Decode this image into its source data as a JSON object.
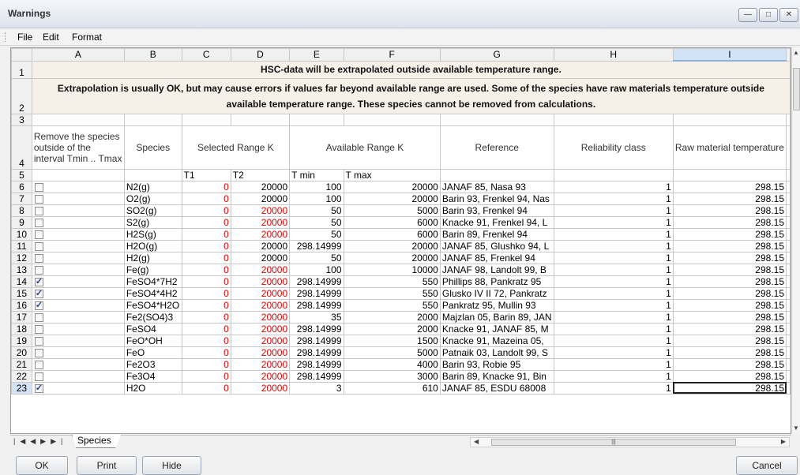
{
  "window": {
    "title": "Warnings"
  },
  "menu": [
    "File",
    "Edit",
    "Format"
  ],
  "columns": [
    "A",
    "B",
    "C",
    "D",
    "E",
    "F",
    "G",
    "H",
    "I"
  ],
  "banner": {
    "line1": "HSC-data will be extrapolated outside available temperature range.",
    "line2": "Extrapolation is usually OK, but may cause errors if values far beyond available range are used. Some of the species have raw materials temperature outside available temperature range. These species cannot be removed from calculations."
  },
  "headers": {
    "remove": "Remove the species outside of the interval Tmin .. Tmax",
    "species": "Species",
    "selected_range": "Selected Range K",
    "available_range": "Available Range K",
    "reference": "Reference",
    "reliability": "Reliability class",
    "raw_temp": "Raw material temperature",
    "t1": "T1",
    "t2": "T2",
    "tmin": "T min",
    "tmax": "T max"
  },
  "rows": [
    {
      "n": "6",
      "checked": false,
      "species": "N2(g)",
      "t1": "0",
      "t2": "20000",
      "t2red": false,
      "tmin": "100",
      "tmax": "20000",
      "ref": "JANAF 85, Nasa 93",
      "rel": "1",
      "raw": "298.15"
    },
    {
      "n": "7",
      "checked": false,
      "species": "O2(g)",
      "t1": "0",
      "t2": "20000",
      "t2red": false,
      "tmin": "100",
      "tmax": "20000",
      "ref": "Barin 93, Frenkel 94, Nas",
      "rel": "1",
      "raw": "298.15"
    },
    {
      "n": "8",
      "checked": false,
      "species": "SO2(g)",
      "t1": "0",
      "t2": "20000",
      "t2red": true,
      "tmin": "50",
      "tmax": "5000",
      "ref": "Barin 93, Frenkel 94",
      "rel": "1",
      "raw": "298.15"
    },
    {
      "n": "9",
      "checked": false,
      "species": "S2(g)",
      "t1": "0",
      "t2": "20000",
      "t2red": true,
      "tmin": "50",
      "tmax": "6000",
      "ref": "Knacke 91, Frenkel 94, L",
      "rel": "1",
      "raw": "298.15"
    },
    {
      "n": "10",
      "checked": false,
      "species": "H2S(g)",
      "t1": "0",
      "t2": "20000",
      "t2red": true,
      "tmin": "50",
      "tmax": "6000",
      "ref": "Barin 89, Frenkel 94",
      "rel": "1",
      "raw": "298.15"
    },
    {
      "n": "11",
      "checked": false,
      "species": "H2O(g)",
      "t1": "0",
      "t2": "20000",
      "t2red": false,
      "tmin": "298.14999",
      "tmax": "20000",
      "ref": "JANAF 85, Glushko 94, L",
      "rel": "1",
      "raw": "298.15"
    },
    {
      "n": "12",
      "checked": false,
      "species": "H2(g)",
      "t1": "0",
      "t2": "20000",
      "t2red": false,
      "tmin": "50",
      "tmax": "20000",
      "ref": "JANAF 85, Frenkel 94",
      "rel": "1",
      "raw": "298.15"
    },
    {
      "n": "13",
      "checked": false,
      "species": "Fe(g)",
      "t1": "0",
      "t2": "20000",
      "t2red": true,
      "tmin": "100",
      "tmax": "10000",
      "ref": "JANAF 98, Landolt 99, B",
      "rel": "1",
      "raw": "298.15"
    },
    {
      "n": "14",
      "checked": true,
      "species": "FeSO4*7H2",
      "t1": "0",
      "t2": "20000",
      "t2red": true,
      "tmin": "298.14999",
      "tmax": "550",
      "ref": "Phillips 88, Pankratz 95",
      "rel": "1",
      "raw": "298.15"
    },
    {
      "n": "15",
      "checked": true,
      "species": "FeSO4*4H2",
      "t1": "0",
      "t2": "20000",
      "t2red": true,
      "tmin": "298.14999",
      "tmax": "550",
      "ref": "Glusko IV II 72, Pankratz",
      "rel": "1",
      "raw": "298.15"
    },
    {
      "n": "16",
      "checked": true,
      "species": "FeSO4*H2O",
      "t1": "0",
      "t2": "20000",
      "t2red": true,
      "tmin": "298.14999",
      "tmax": "550",
      "ref": "Pankratz 95, Mullin 93",
      "rel": "1",
      "raw": "298.15"
    },
    {
      "n": "17",
      "checked": false,
      "species": "Fe2(SO4)3",
      "t1": "0",
      "t2": "20000",
      "t2red": true,
      "tmin": "35",
      "tmax": "2000",
      "ref": "Majzlan 05, Barin 89, JAN",
      "rel": "1",
      "raw": "298.15"
    },
    {
      "n": "18",
      "checked": false,
      "species": "FeSO4",
      "t1": "0",
      "t2": "20000",
      "t2red": true,
      "tmin": "298.14999",
      "tmax": "2000",
      "ref": "Knacke 91, JANAF 85, M",
      "rel": "1",
      "raw": "298.15"
    },
    {
      "n": "19",
      "checked": false,
      "species": "FeO*OH",
      "t1": "0",
      "t2": "20000",
      "t2red": true,
      "tmin": "298.14999",
      "tmax": "1500",
      "ref": "Knacke 91, Mazeina 05,",
      "rel": "1",
      "raw": "298.15"
    },
    {
      "n": "20",
      "checked": false,
      "species": "FeO",
      "t1": "0",
      "t2": "20000",
      "t2red": true,
      "tmin": "298.14999",
      "tmax": "5000",
      "ref": "Patnaik 03, Landolt 99, S",
      "rel": "1",
      "raw": "298.15"
    },
    {
      "n": "21",
      "checked": false,
      "species": "Fe2O3",
      "t1": "0",
      "t2": "20000",
      "t2red": true,
      "tmin": "298.14999",
      "tmax": "4000",
      "ref": "Barin 93, Robie 95",
      "rel": "1",
      "raw": "298.15"
    },
    {
      "n": "22",
      "checked": false,
      "species": "Fe3O4",
      "t1": "0",
      "t2": "20000",
      "t2red": true,
      "tmin": "298.14999",
      "tmax": "3000",
      "ref": "Barin 89, Knacke 91, Bin",
      "rel": "1",
      "raw": "298.15"
    },
    {
      "n": "23",
      "checked": true,
      "species": "H2O",
      "t1": "0",
      "t2": "20000",
      "t2red": true,
      "tmin": "3",
      "tmax": "610",
      "ref": "JANAF 85, ESDU 68008",
      "rel": "1",
      "raw": "298.15"
    }
  ],
  "sheet_tab": "Species",
  "buttons": {
    "ok": "OK",
    "print": "Print",
    "hide": "Hide",
    "cancel": "Cancel"
  },
  "colors": {
    "red": "#e00000",
    "selected": "#d3e3f7",
    "banner_bg": "#f5f0e8"
  }
}
